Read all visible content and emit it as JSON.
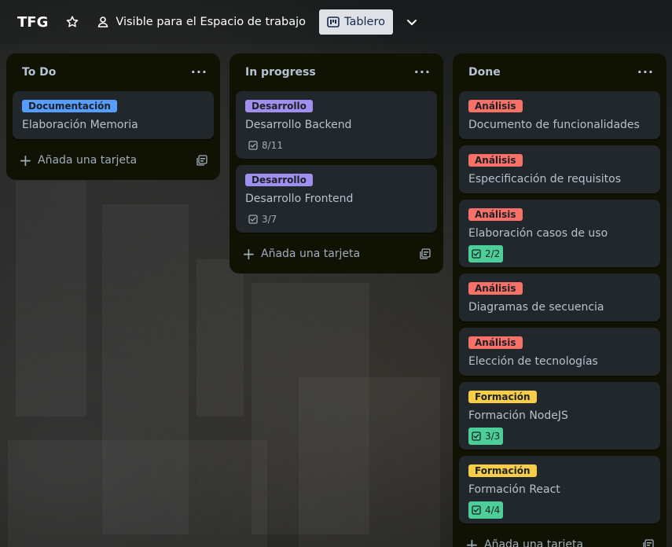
{
  "header": {
    "board_title": "TFG",
    "visibility": "Visible para el Espacio de trabajo",
    "view_label": "Tablero"
  },
  "colors": {
    "Documentación": "#579dff",
    "Desarrollo": "#9f8fef",
    "Análisis": "#f87168",
    "Formación": "#f5cd47",
    "badge_done": "#4bce97"
  },
  "add_card_label": "Añada una tarjeta",
  "lists": [
    {
      "title": "To Do",
      "cards": [
        {
          "label": "Documentación",
          "label_color": "#579dff",
          "title": "Elaboración Memoria"
        }
      ]
    },
    {
      "title": "In progress",
      "cards": [
        {
          "label": "Desarrollo",
          "label_color": "#9f8fef",
          "title": "Desarrollo Backend",
          "checklist": "8/11",
          "complete": false
        },
        {
          "label": "Desarrollo",
          "label_color": "#9f8fef",
          "title": "Desarrollo Frontend",
          "checklist": "3/7",
          "complete": false
        }
      ]
    },
    {
      "title": "Done",
      "cards": [
        {
          "label": "Análisis",
          "label_color": "#f87168",
          "title": "Documento de funcionalidades"
        },
        {
          "label": "Análisis",
          "label_color": "#f87168",
          "title": "Especificación de requisitos"
        },
        {
          "label": "Análisis",
          "label_color": "#f87168",
          "title": "Elaboración casos de uso",
          "checklist": "2/2",
          "complete": true
        },
        {
          "label": "Análisis",
          "label_color": "#f87168",
          "title": "Diagramas de secuencia"
        },
        {
          "label": "Análisis",
          "label_color": "#f87168",
          "title": "Elección de tecnologías"
        },
        {
          "label": "Formación",
          "label_color": "#f5cd47",
          "title": "Formación NodeJS",
          "checklist": "3/3",
          "complete": true
        },
        {
          "label": "Formación",
          "label_color": "#f5cd47",
          "title": "Formación React",
          "checklist": "4/4",
          "complete": true
        }
      ]
    }
  ]
}
